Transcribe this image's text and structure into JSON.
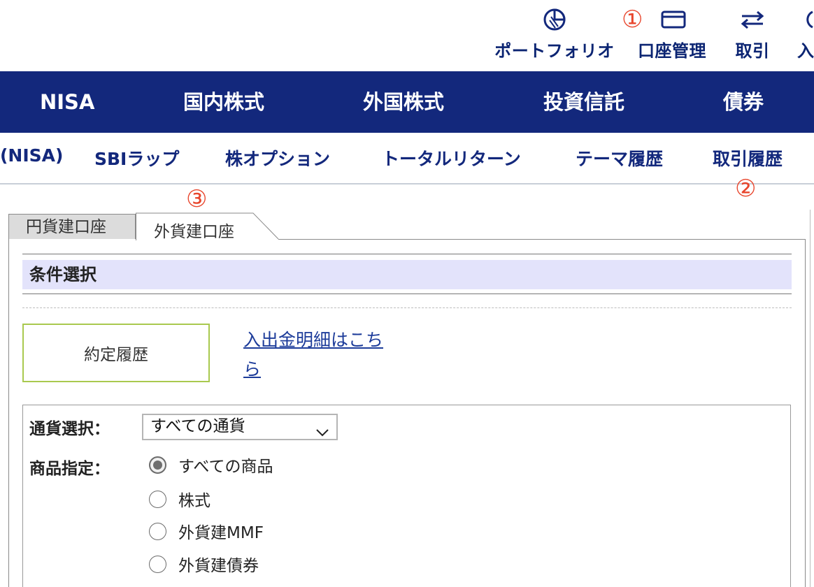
{
  "utility_nav": {
    "portfolio": {
      "label": "ポートフォリオ",
      "icon": "pie-chart-icon"
    },
    "account": {
      "label": "口座管理",
      "icon": "card-icon"
    },
    "trade": {
      "label": "取引",
      "icon": "swap-arrows-icon"
    },
    "deposit": {
      "label": "入",
      "icon": "partial-icon"
    }
  },
  "annotations": {
    "one": "①",
    "two": "②",
    "three": "③"
  },
  "main_nav": [
    "NISA",
    "国内株式",
    "外国株式",
    "投資信託",
    "債券"
  ],
  "sub_nav": [
    "(NISA)",
    "SBIラップ",
    "株オプション",
    "トータルリターン",
    "テーマ履歴",
    "取引履歴"
  ],
  "tabs": {
    "yen": "円貨建口座",
    "foreign": "外貨建口座"
  },
  "section": {
    "title": "条件選択"
  },
  "history_button": "約定履歴",
  "cash_link": "入出金明細はこちら",
  "filter": {
    "currency_label": "通貨選択：",
    "currency_value": "すべての通貨",
    "product_label": "商品指定：",
    "products": [
      "すべての商品",
      "株式",
      "外貨建MMF",
      "外貨建債券"
    ],
    "selected_product": "すべての商品"
  },
  "colors": {
    "nav_bg": "#13287c",
    "nav_text": "#13287c",
    "annotation": "#e8452c",
    "section_bg": "#e3e3fb",
    "button_border": "#a9c94f"
  }
}
